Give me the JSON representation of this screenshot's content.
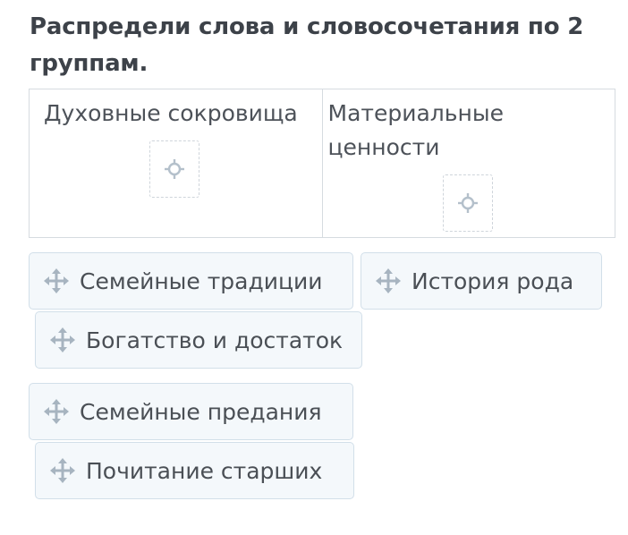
{
  "task": {
    "title": "Распредели слова и словосочетания по 2 группам."
  },
  "groups": [
    {
      "label": "Духовные сокровища",
      "dropzone_icon": "move-target-icon"
    },
    {
      "label": "Материальные ценности",
      "dropzone_icon": "move-target-icon"
    }
  ],
  "items": [
    {
      "label": "Семейные традиции",
      "icon": "move-arrows-icon"
    },
    {
      "label": "История рода",
      "icon": "move-arrows-icon"
    },
    {
      "label": "Богатство и достаток",
      "icon": "move-arrows-icon"
    },
    {
      "label": "Семейные предания",
      "icon": "move-arrows-icon"
    },
    {
      "label": "Почитание старших",
      "icon": "move-arrows-icon"
    }
  ],
  "colors": {
    "card_bg": "#f4f8fb",
    "card_border": "#d2dfe9",
    "icon": "#a7b4c0",
    "title": "#3d4249"
  }
}
